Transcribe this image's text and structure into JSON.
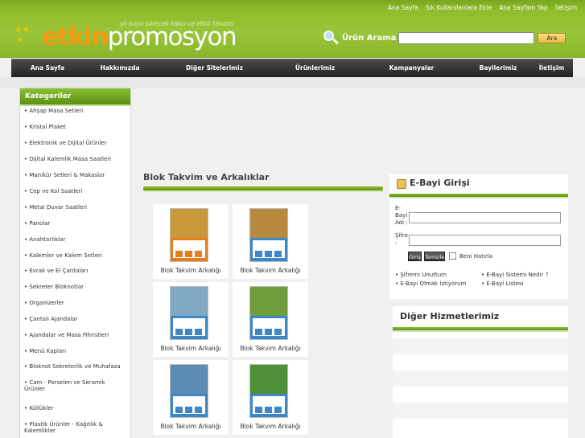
{
  "header": {
    "top_links": [
      "Ana Sayfa",
      "Sık Kullanılanlara Ekle",
      "Ana Sayfam Yap",
      "İletişim"
    ],
    "logo_part1": "etkin",
    "logo_part2": "promosyon",
    "tagline": "yıl boyu sürecek kalıcı ve etkili tanıtım",
    "search_label": "Ürün Arama",
    "search_value": "",
    "search_button": "Ara"
  },
  "nav": [
    "Ana Sayfa",
    "Hakkımızda",
    "Diğer Sitelerimiz",
    "Ürünlerimiz",
    "Kampanyalar",
    "Bayilerimiz",
    "İletişim"
  ],
  "sidebar": {
    "title": "Kategoriler",
    "items": [
      "• Ahşap Masa Setleri",
      "• Kristal Plaket",
      "• Elektronik ve Dijital Ürünler",
      "• Dijital Kalemlik Masa Saatleri",
      "• Manikür Setleri & Makaslar",
      "• Cep ve Kol Saatleri",
      "• Metal Duvar Saatleri",
      "• Panolar",
      "• Anahtarlıklar",
      "• Kalemler ve Kalem Setleri",
      "• Evrak ve El Çantaları",
      "• Sekreter Bloknotlar",
      "• Organizerler",
      "• Çantalı Ajandalar",
      "• Ajandalar ve Masa Fihristleri",
      "• Menü Kapları",
      "• Bloknot Sekreterlik ve Muhafaza",
      "• Cam - Porselen ve Seramik Ürünler",
      "• Küllükler",
      "• Plastik Ürünler - Kağıtlık & Kalemlikler"
    ]
  },
  "content": {
    "title": "Blok Takvim ve Arkalıklar",
    "products": [
      {
        "label": "Blok Takvim Arkalığı",
        "color": "#e77d19",
        "photo": "#c8983a"
      },
      {
        "label": "Blok Takvim Arkalığı",
        "color": "#3b87c7",
        "photo": "#b88a3e"
      },
      {
        "label": "Blok Takvim Arkalığı",
        "color": "#3b87c7",
        "photo": "#7fa8c4"
      },
      {
        "label": "Blok Takvim Arkalığı",
        "color": "#3b87c7",
        "photo": "#6d9d3c"
      },
      {
        "label": "Blok Takvim Arkalığı",
        "color": "#3b87c7",
        "photo": "#5c8cb2"
      },
      {
        "label": "Blok Takvim Arkalığı",
        "color": "#3b87c7",
        "photo": "#4f8f3a"
      }
    ]
  },
  "ebayi": {
    "title": "E-Bayi Girişi",
    "username_label_1": "E-",
    "username_label_2": "Bayi",
    "username_label_3": "Adı",
    "username_label_4": ":",
    "password_label_1": "Şifre",
    "password_label_2": ":",
    "username_value": "",
    "password_value": "",
    "login_button": "Giriş",
    "clear_button": "Temizle",
    "remember_label": "Beni Hatırla",
    "links": [
      "• Şifremi Unuttum",
      "• E-Bayi Olmak İstiyorum",
      "• E-Bayi Sistemi Nedir ?",
      "• E-Bayi Listesi"
    ]
  },
  "services": {
    "title": "Diğer Hizmetlerimiz"
  }
}
